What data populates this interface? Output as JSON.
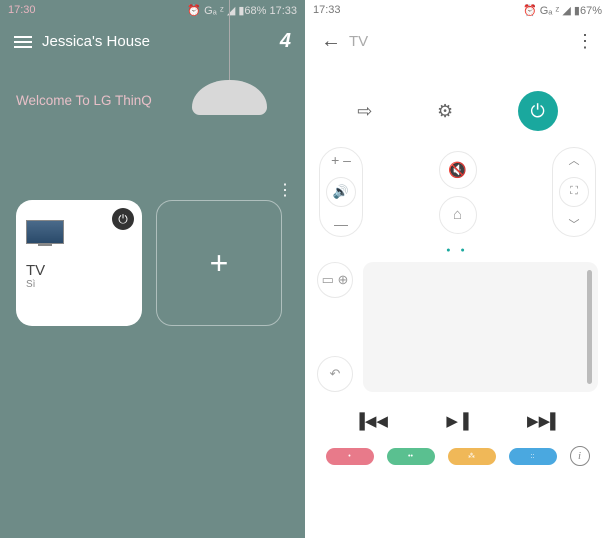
{
  "left": {
    "status": {
      "time": "17:30",
      "icons": "••• ⁝⁝⁝",
      "right": "⏰ Gₐ ᶻ ◢ ▮68% 17:33"
    },
    "header": {
      "title": "Jessica's House",
      "notif": "4"
    },
    "welcome": "Welcome To LG ThinQ",
    "tv_card": {
      "label": "TV",
      "sub": "Sì"
    },
    "add_card": "+"
  },
  "right": {
    "status": {
      "time": "17:33",
      "icons": "••• ⁝⁝⁝",
      "right": "⏰ Gₐ ᶻ ◢ ▮67%"
    },
    "header": {
      "title": "TV"
    },
    "vol": {
      "up": "+ –",
      "mid": "🔊",
      "down": "—"
    },
    "ch": {
      "up": "︿",
      "mid": "⛶",
      "down": "﹀"
    },
    "mute": "🔇",
    "home": "⌂",
    "page_dots": "● ●",
    "tp_btn1": "▭ ⊕",
    "tp_btn2": "↶",
    "media": {
      "prev": "▐◀◀",
      "play": "▶▐",
      "next": "▶▶▌"
    },
    "colors": {
      "red": "•",
      "green": "••",
      "yellow": "⁂",
      "blue": "::"
    },
    "info": "i"
  }
}
